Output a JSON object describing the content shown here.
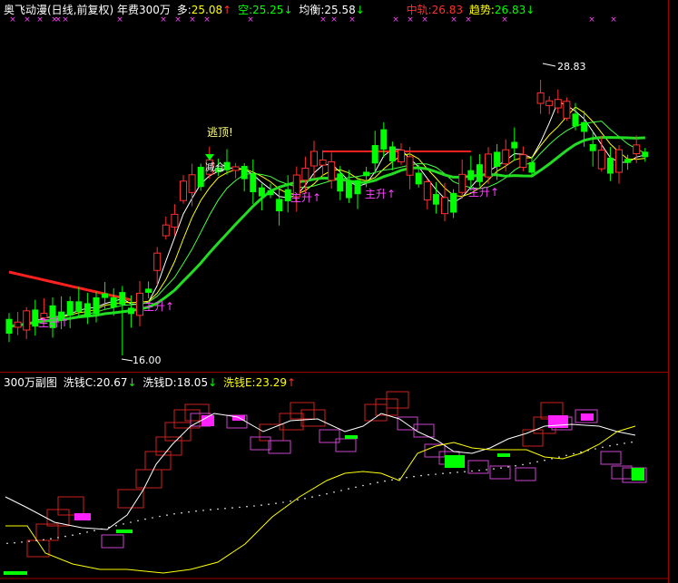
{
  "main_header": {
    "title": "奥飞动漫(日线,前复权) 年费300万",
    "duo_label": "多:",
    "duo_value": "25.08",
    "duo_arrow": "↑",
    "kong_label": "空:",
    "kong_value": "25.25",
    "kong_arrow": "↓",
    "junheng_label": "均衡:",
    "junheng_value": "25.58",
    "junheng_arrow": "↓",
    "zhonggui_label": "中轨:",
    "zhonggui_value": "26.83",
    "qushi_label": "趋势:",
    "qushi_value": "26.83",
    "qushi_arrow": "↓"
  },
  "sub_header": {
    "title": "300万副图",
    "c_label": "洗钱C:",
    "c_value": "20.67",
    "c_arrow": "↓",
    "d_label": "洗钱D:",
    "d_value": "18.05",
    "d_arrow": "↓",
    "e_label": "洗钱E:",
    "e_value": "23.29",
    "e_arrow": "↑"
  },
  "annotations": {
    "high_price": "28.83",
    "low_price": "16.00",
    "escape_top": "逃顶!",
    "reduce_position": "减仓",
    "rise_label": "主升↑"
  },
  "colors": {
    "up_candle": "#ff3030",
    "down_candle": "#00ff00",
    "trend_red": "#ff2020",
    "trend_green": "#22dd22",
    "ma_white": "#ffffff",
    "ma_yellow": "#ffff00",
    "box_magenta": "#cc44cc",
    "rise_label": "#ff44ff",
    "separator": "#a00000"
  }
}
